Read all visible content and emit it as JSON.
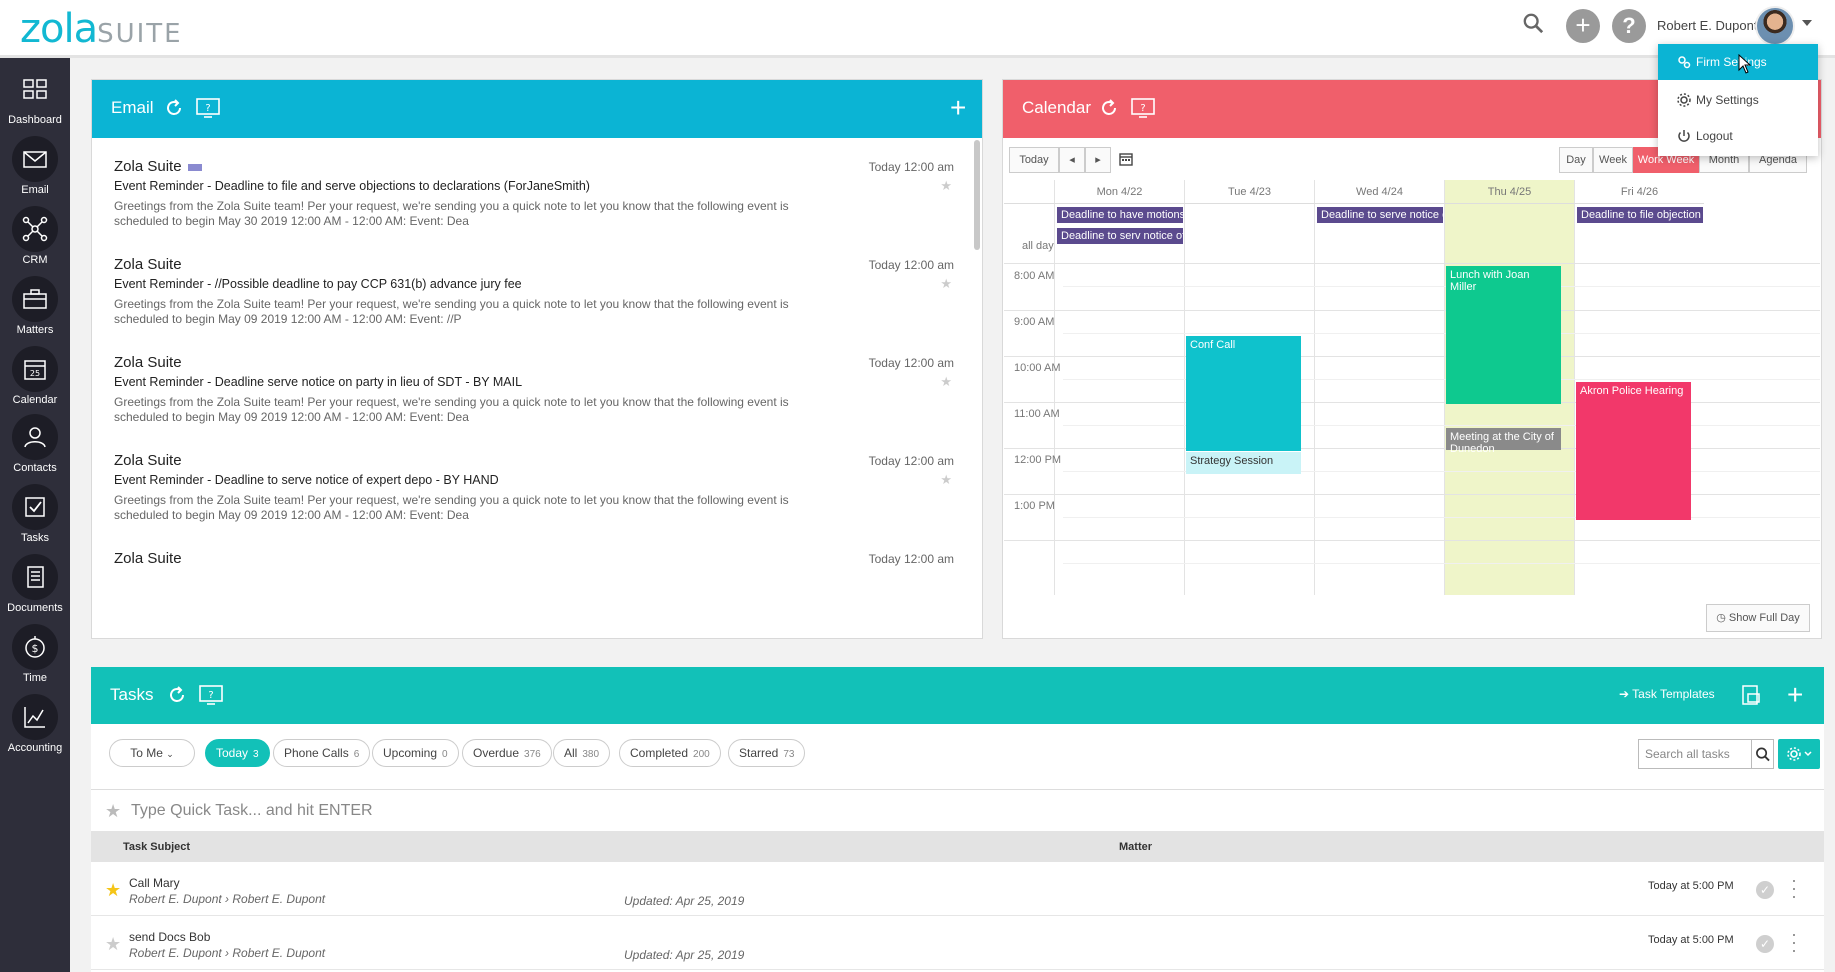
{
  "brand": {
    "logo_main": "zola",
    "logo_sub": "SUITE",
    "accent": "#0bb4d4"
  },
  "header": {
    "user_name": "Robert E. Dupont",
    "plus_label": "+",
    "help_label": "?"
  },
  "user_menu": {
    "items": [
      {
        "label": "Firm Settings",
        "icon": "gears-icon"
      },
      {
        "label": "My Settings",
        "icon": "gear-icon"
      },
      {
        "label": "Logout",
        "icon": "power-icon"
      }
    ]
  },
  "sidebar": {
    "items": [
      {
        "label": "Dashboard",
        "icon": "dashboard-icon"
      },
      {
        "label": "Email",
        "icon": "envelope-icon"
      },
      {
        "label": "CRM",
        "icon": "network-icon"
      },
      {
        "label": "Matters",
        "icon": "briefcase-icon"
      },
      {
        "label": "Calendar",
        "icon": "calendar-icon",
        "badge": "25"
      },
      {
        "label": "Contacts",
        "icon": "contacts-icon"
      },
      {
        "label": "Tasks",
        "icon": "checkbox-icon"
      },
      {
        "label": "Documents",
        "icon": "document-icon"
      },
      {
        "label": "Time",
        "icon": "stopwatch-dollar-icon"
      },
      {
        "label": "Accounting",
        "icon": "chart-icon"
      }
    ]
  },
  "email": {
    "title": "Email",
    "color": "#0bb4d4",
    "plus": "+",
    "messages": [
      {
        "from": "Zola Suite",
        "time": "Today 12:00 am",
        "subject": "Event Reminder - Deadline to file and serve objections to declarations (ForJaneSmith)",
        "preview": "Greetings from the Zola Suite team! Per your request, we're sending you a quick note to let you know that the following event is scheduled to begin May 30 2019 12:00 AM - 12:00 AM: Event: Dea"
      },
      {
        "from": "Zola Suite",
        "time": "Today 12:00 am",
        "subject": "Event Reminder - //Possible deadline to pay CCP 631(b) advance jury fee",
        "preview": "Greetings from the Zola Suite team! Per your request, we're sending you a quick note to let you know that the following event is scheduled to begin May 09 2019 12:00 AM - 12:00 AM: Event: //P"
      },
      {
        "from": "Zola Suite",
        "time": "Today 12:00 am",
        "subject": "Event Reminder - Deadline serve notice on party in lieu of SDT - BY MAIL",
        "preview": "Greetings from the Zola Suite team! Per your request, we're sending you a quick note to let you know that the following event is scheduled to begin May 09 2019 12:00 AM - 12:00 AM: Event: Dea"
      },
      {
        "from": "Zola Suite",
        "time": "Today 12:00 am",
        "subject": "Event Reminder - Deadline to serve notice of expert depo - BY HAND",
        "preview": "Greetings from the Zola Suite team! Per your request, we're sending you a quick note to let you know that the following event is scheduled to begin May 09 2019 12:00 AM - 12:00 AM: Event: Dea"
      },
      {
        "from": "Zola Suite",
        "time": "Today 12:00 am",
        "subject": "",
        "preview": ""
      }
    ]
  },
  "calendar": {
    "title": "Calendar",
    "color": "#f05f6b",
    "nav": {
      "today": "Today",
      "prev": "◂",
      "next": "▸"
    },
    "views": [
      "Day",
      "Week",
      "Work Week",
      "Month",
      "Agenda"
    ],
    "active_view": "Work Week",
    "days": [
      "Mon 4/22",
      "Tue 4/23",
      "Wed 4/24",
      "Thu 4/25",
      "Fri 4/26"
    ],
    "all_day_label": "all day",
    "times": [
      "8:00 AM",
      "9:00 AM",
      "10:00 AM",
      "11:00 AM",
      "12:00 PM",
      "1:00 PM"
    ],
    "all_day_events": [
      {
        "title": "Deadline to have motions re e"
      },
      {
        "title": "Deadline to serv notice of dep"
      },
      {
        "title": "Deadline to serve notice of de"
      },
      {
        "title": "Deadline to file objection to p"
      }
    ],
    "events": [
      {
        "title": "Conf Call",
        "color": "#0fc2cc"
      },
      {
        "title": "Strategy Session",
        "color": "#c9f3f7"
      },
      {
        "title": "Lunch with Joan Miller",
        "color": "#0ec98f"
      },
      {
        "title": "Meeting at the City of Dunedon",
        "color": "#8a8a8a"
      },
      {
        "title": "Akron Police Hearing",
        "color": "#f2386a"
      }
    ],
    "show_full_day": "Show Full Day"
  },
  "tasks": {
    "title": "Tasks",
    "color": "#12c1b8",
    "templates_label": "Task Templates",
    "plus": "+",
    "assignee_filter": "To Me",
    "filters": [
      {
        "label": "Today",
        "count": "3"
      },
      {
        "label": "Phone Calls",
        "count": "6"
      },
      {
        "label": "Upcoming",
        "count": "0"
      },
      {
        "label": "Overdue",
        "count": "376"
      },
      {
        "label": "All",
        "count": "380"
      },
      {
        "label": "Completed",
        "count": "200"
      },
      {
        "label": "Starred",
        "count": "73"
      }
    ],
    "search_placeholder": "Search all tasks",
    "quick_task_placeholder": "Type Quick Task... and hit ENTER",
    "columns": {
      "subject": "Task Subject",
      "matter": "Matter"
    },
    "rows": [
      {
        "subject": "Call Mary",
        "from": "Robert E. Dupont",
        "to": "Robert E. Dupont",
        "updated": "Updated: Apr 25, 2019",
        "due": "Today at 5:00 PM",
        "starred": true
      },
      {
        "subject": "send Docs Bob",
        "from": "Robert E. Dupont",
        "to": "Robert E. Dupont",
        "updated": "Updated: Apr 25, 2019",
        "due": "Today at 5:00 PM",
        "starred": false
      }
    ]
  }
}
